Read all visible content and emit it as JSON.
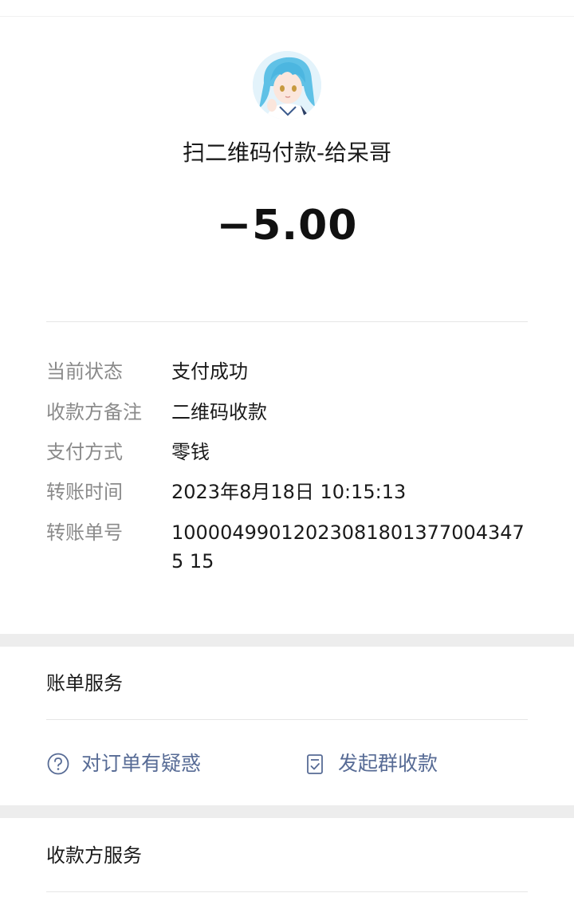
{
  "header": {
    "avatar_icon": "anime-character-avatar-icon",
    "title": "扫二维码付款-给呆哥",
    "amount": "−5.00"
  },
  "details": [
    {
      "label": "当前状态",
      "value": "支付成功"
    },
    {
      "label": "收款方备注",
      "value": "二维码收款"
    },
    {
      "label": "支付方式",
      "value": "零钱"
    },
    {
      "label": "转账时间",
      "value": "2023年8月18日 10:15:13"
    },
    {
      "label": "转账单号",
      "value": "100004990120230818013770043475 15"
    }
  ],
  "bill_service": {
    "title": "账单服务",
    "actions": [
      {
        "label": "对订单有疑惑",
        "icon": "question-circle-icon"
      },
      {
        "label": "发起群收款",
        "icon": "document-check-icon"
      }
    ]
  },
  "payee_service": {
    "title": "收款方服务"
  },
  "colors": {
    "link": "#576b95",
    "label": "#8a8a8a",
    "band": "#ededed"
  }
}
